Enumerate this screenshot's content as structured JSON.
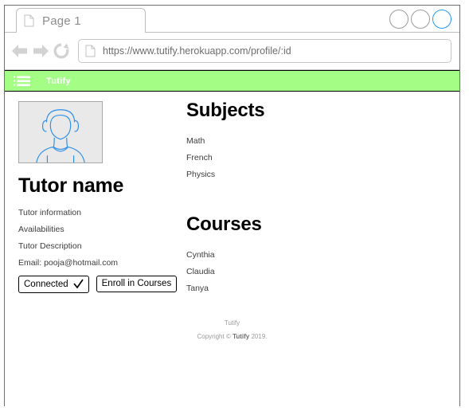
{
  "browser": {
    "tab": {
      "label": "Page 1",
      "icon": "page-icon"
    },
    "window_controls": [
      {
        "name": "minimize-circle",
        "color": "#9b9b9b"
      },
      {
        "name": "maximize-circle",
        "color": "#9b9b9b"
      },
      {
        "name": "close-circle",
        "color": "#1f9bf0"
      }
    ],
    "nav": {
      "back": "back-arrow-icon",
      "forward": "forward-arrow-icon",
      "reload": "reload-icon"
    },
    "address": {
      "icon": "page-icon",
      "url": "https://www.tutify.herokuapp.com/profile/:id"
    }
  },
  "appbar": {
    "menu_icon": "list-menu-icon",
    "brand": "Tutify",
    "background": "#a4fe86",
    "text_color": "#ffffff"
  },
  "profile": {
    "avatar": "person-placeholder-icon",
    "name": "Tutor name",
    "details": [
      "Tutor information",
      "Availabilities",
      "Tutor Description",
      "Email: pooja@hotmail.com"
    ],
    "buttons": {
      "connected": {
        "label": "Connected",
        "icon": "checkmark-icon"
      },
      "enroll": {
        "label": "Enroll in Courses"
      }
    }
  },
  "subjects": {
    "title": "Subjects",
    "items": [
      "Math",
      "French",
      "Physics"
    ]
  },
  "courses": {
    "title": "Courses",
    "items": [
      "Cynthia",
      "Claudia",
      "Tanya"
    ]
  },
  "footer": {
    "brand": "Tutify",
    "copyright_prefix": "Copyright © ",
    "copyright_brand": "Tutify",
    "copyright_suffix": " 2019."
  }
}
